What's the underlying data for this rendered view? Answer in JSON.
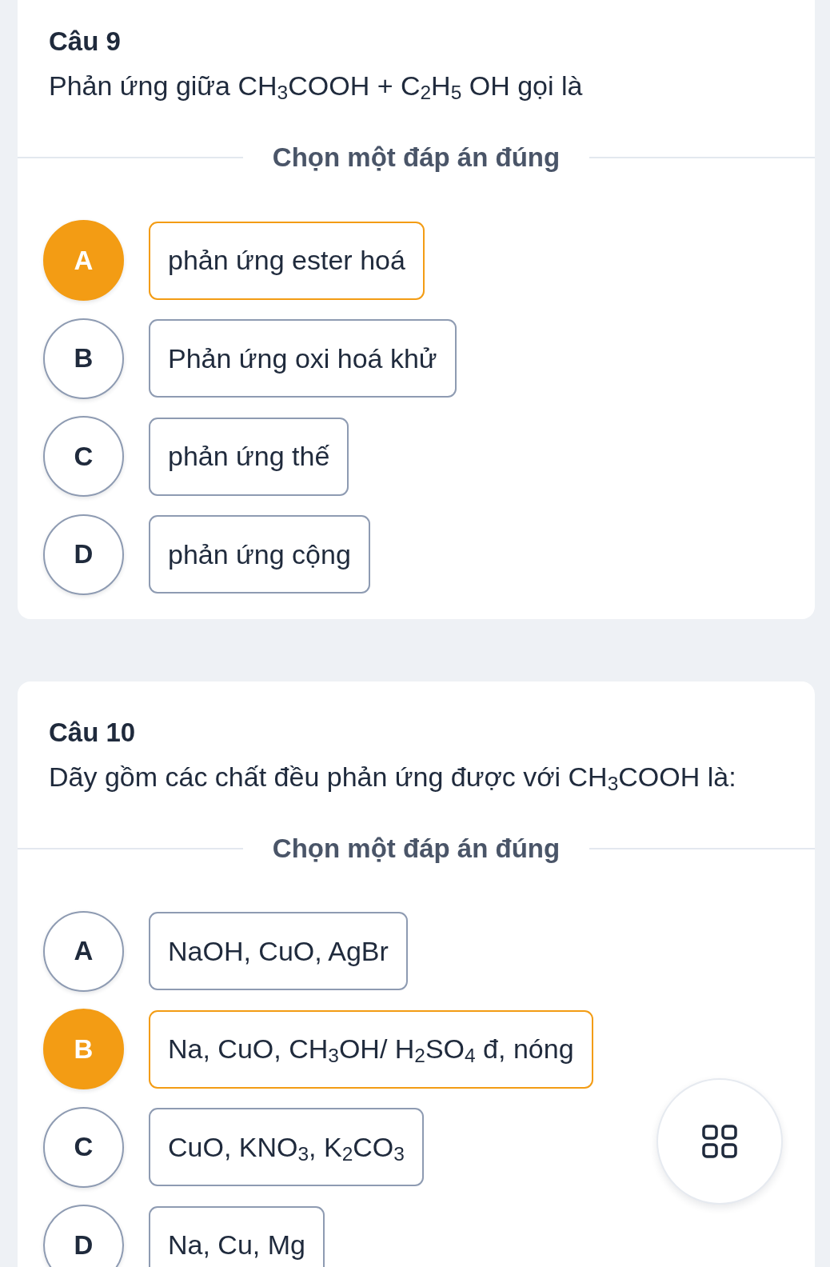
{
  "questions": [
    {
      "title": "Câu 9",
      "prompt": "Phản ứng giữa CH$_{3}$COOH + C$_{2}$H$_{5}$ OH gọi là",
      "instruction": "Chọn một đáp án đúng",
      "options": [
        {
          "letter": "A",
          "text": "phản ứng ester hoá",
          "selected": true
        },
        {
          "letter": "B",
          "text": "Phản ứng oxi hoá khử",
          "selected": false
        },
        {
          "letter": "C",
          "text": "phản ứng thế",
          "selected": false
        },
        {
          "letter": "D",
          "text": "phản ứng cộng",
          "selected": false
        }
      ]
    },
    {
      "title": "Câu 10",
      "prompt": "Dãy gồm các chất đều phản ứng được với CH$_{3}$COOH là:",
      "instruction": "Chọn một đáp án đúng",
      "options": [
        {
          "letter": "A",
          "text": "NaOH, CuO, AgBr",
          "selected": false
        },
        {
          "letter": "B",
          "text": "Na, CuO, CH$_{3}$OH/ H$_{2}$SO$_{4}$ đ, nóng",
          "selected": true
        },
        {
          "letter": "C",
          "text": "CuO, KNO$_{3}$, K$_{2}$CO$_{3}$",
          "selected": false
        },
        {
          "letter": "D",
          "text": "Na, Cu, Mg",
          "selected": false
        }
      ]
    }
  ]
}
